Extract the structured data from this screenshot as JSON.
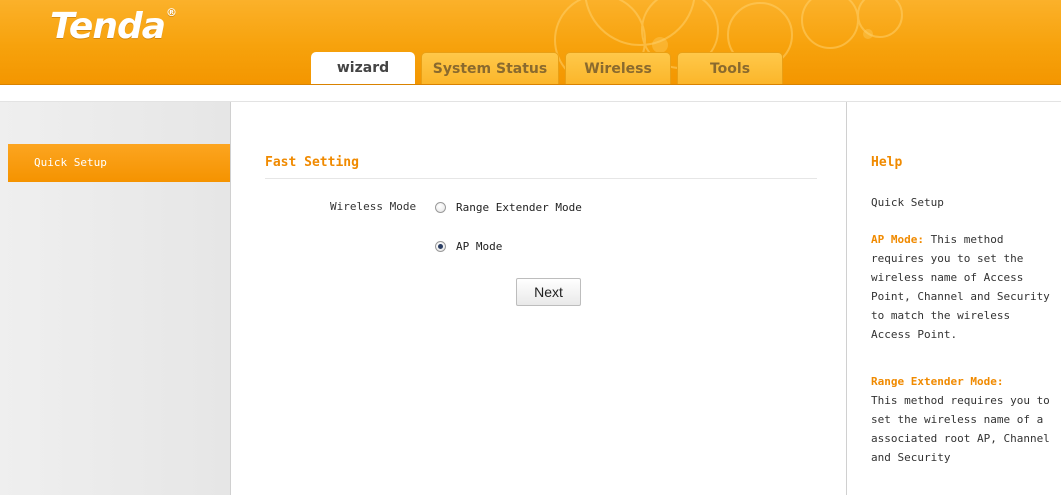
{
  "header": {
    "logo_text": "Tenda",
    "logo_mark": "®",
    "tabs": [
      {
        "label": "wizard",
        "active": true
      },
      {
        "label": "System Status",
        "active": false
      },
      {
        "label": "Wireless",
        "active": false
      },
      {
        "label": "Tools",
        "active": false
      }
    ]
  },
  "sidebar": {
    "items": [
      {
        "label": "Quick Setup",
        "active": true
      }
    ]
  },
  "main": {
    "section_title": "Fast Setting",
    "wireless_mode_label": "Wireless Mode",
    "options": [
      {
        "label": "Range Extender Mode",
        "checked": false
      },
      {
        "label": "AP Mode",
        "checked": true
      }
    ],
    "next_label": "Next"
  },
  "help": {
    "title": "Help",
    "subtitle": "Quick Setup",
    "ap_heading": "AP Mode:",
    "ap_text": " This method requires you to set the wireless name of Access Point, Channel and Security to match the wireless Access Point.",
    "re_heading": "Range Extender Mode:",
    "re_text": "This method requires you to set the wireless name of a associated root AP, Channel and Security"
  },
  "colors": {
    "accent": "#f08a00",
    "header_orange": "#f7a20c",
    "active_menu": "#f7a10e"
  }
}
